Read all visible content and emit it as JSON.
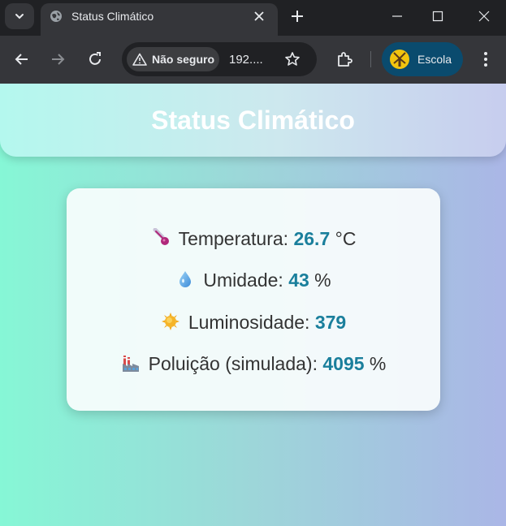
{
  "browser": {
    "tab": {
      "title": "Status Climático"
    },
    "omnibox": {
      "security_label": "Não seguro",
      "url": "192...."
    },
    "profile": {
      "name": "Escola"
    }
  },
  "page": {
    "title": "Status Climático",
    "rows": [
      {
        "icon": "thermometer-icon",
        "label": "Temperatura: ",
        "value": "26.7",
        "unit": " °C"
      },
      {
        "icon": "droplet-icon",
        "label": "Umidade: ",
        "value": "43",
        "unit": " %"
      },
      {
        "icon": "sun-icon",
        "label": "Luminosidade: ",
        "value": "379",
        "unit": ""
      },
      {
        "icon": "factory-icon",
        "label": "Poluição (simulada): ",
        "value": "4095",
        "unit": " %"
      }
    ]
  },
  "colors": {
    "value_accent": "#1a7f9c",
    "gradient_left": "#86f7d6",
    "gradient_right": "#aab6e6"
  }
}
